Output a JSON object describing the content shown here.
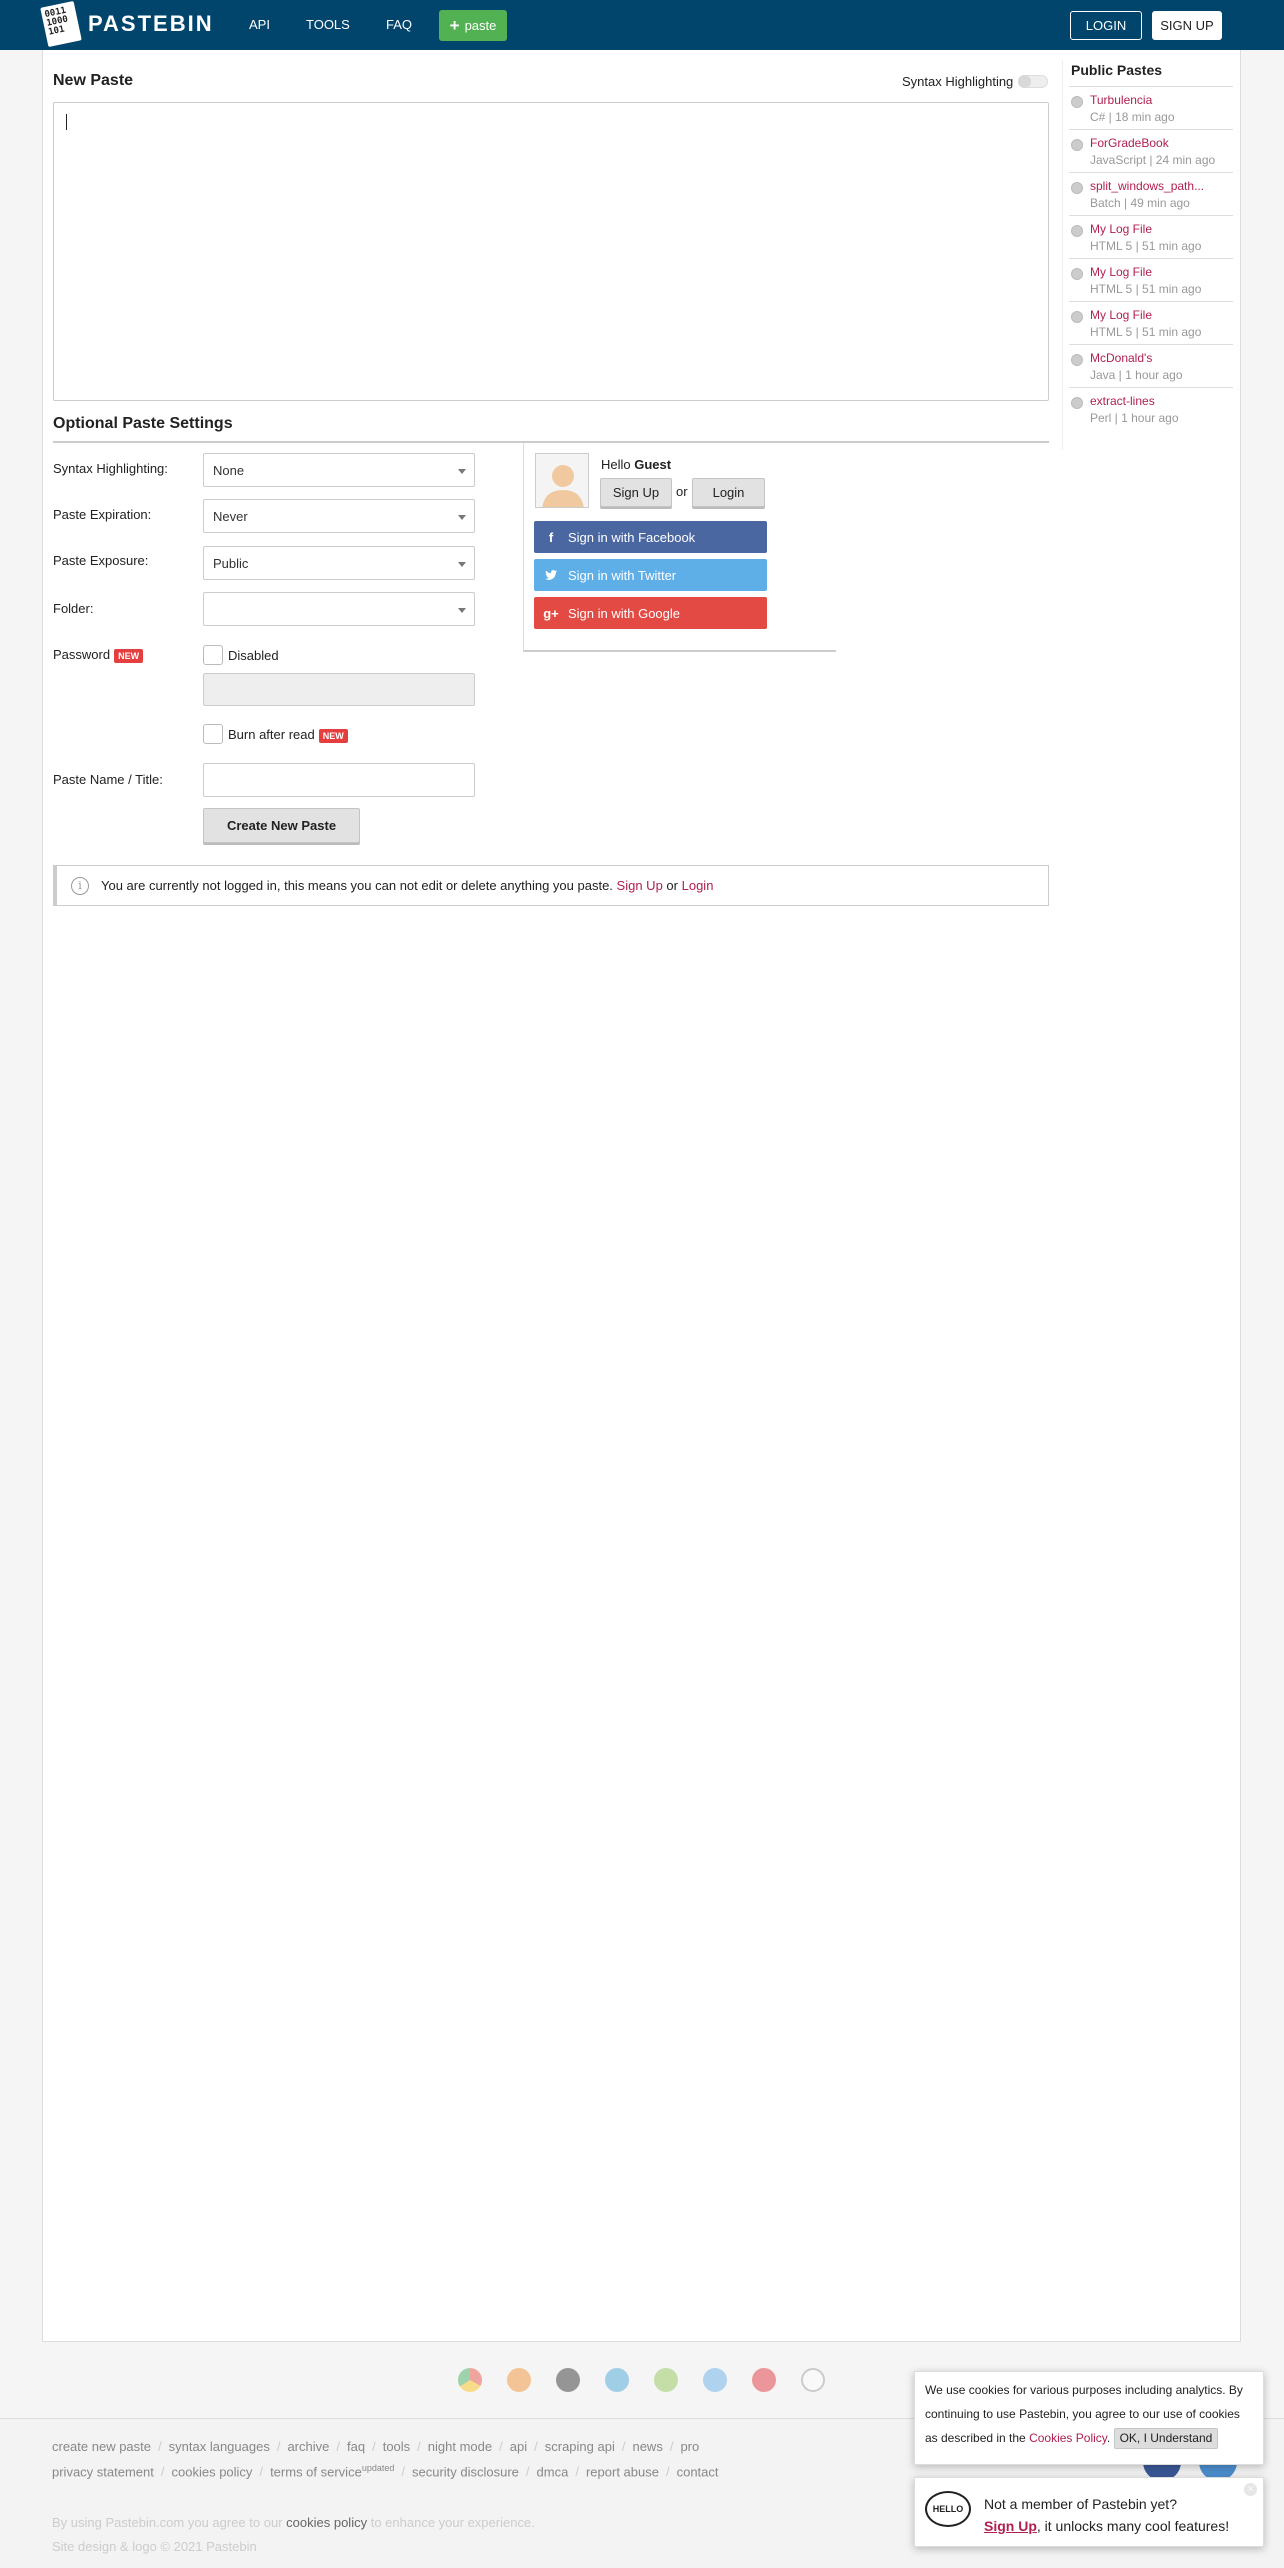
{
  "header": {
    "logo_digits": "0011\n1000\n101",
    "logo_text": "PASTEBIN",
    "nav": [
      "API",
      "TOOLS",
      "FAQ"
    ],
    "paste_label": "paste",
    "login": "LOGIN",
    "signup": "SIGN UP"
  },
  "editor": {
    "title": "New Paste",
    "syntax_toggle_label": "Syntax Highlighting"
  },
  "settings": {
    "title": "Optional Paste Settings",
    "syntax_label": "Syntax Highlighting:",
    "syntax_value": "None",
    "expiration_label": "Paste Expiration:",
    "expiration_value": "Never",
    "exposure_label": "Paste Exposure:",
    "exposure_value": "Public",
    "folder_label": "Folder:",
    "folder_value": "",
    "password_label": "Password",
    "new_badge": "NEW",
    "password_checkbox": "Disabled",
    "burn_label": "Burn after read",
    "name_label": "Paste Name / Title:",
    "create_button": "Create New Paste"
  },
  "guest": {
    "hello": "Hello",
    "name": "Guest",
    "signup": "Sign Up",
    "or": "or",
    "login": "Login",
    "facebook": "Sign in with Facebook",
    "twitter": "Sign in with Twitter",
    "google": "Sign in with Google"
  },
  "notice": {
    "text": "You are currently not logged in, this means you can not edit or delete anything you paste.",
    "signup": "Sign Up",
    "or": "or",
    "login": "Login"
  },
  "public_pastes": {
    "title": "Public Pastes",
    "items": [
      {
        "name": "Turbulencia",
        "meta": "C# | 18 min ago"
      },
      {
        "name": "ForGradeBook",
        "meta": "JavaScript | 24 min ago"
      },
      {
        "name": "split_windows_path...",
        "meta": "Batch | 49 min ago"
      },
      {
        "name": "My Log File",
        "meta": "HTML 5 | 51 min ago"
      },
      {
        "name": "My Log File",
        "meta": "HTML 5 | 51 min ago"
      },
      {
        "name": "My Log File",
        "meta": "HTML 5 | 51 min ago"
      },
      {
        "name": "McDonald's",
        "meta": "Java | 1 hour ago"
      },
      {
        "name": "extract-lines",
        "meta": "Perl | 1 hour ago"
      }
    ]
  },
  "footer": {
    "links_row1": [
      "create new paste",
      "syntax languages",
      "archive",
      "faq",
      "tools",
      "night mode",
      "api",
      "scraping api",
      "news",
      "pro"
    ],
    "links_row2": [
      "privacy statement",
      "cookies policy",
      "terms of service",
      "security disclosure",
      "dmca",
      "report abuse",
      "contact"
    ],
    "updated_sup": "updated",
    "note_pre": "By using Pastebin.com you agree to our",
    "note_link": "cookies policy",
    "note_post": "to enhance your experience.",
    "copyright": "Site design & logo © 2021 Pastebin"
  },
  "cookie_popup": {
    "text": "We use cookies for various purposes including analytics. By continuing to use Pastebin, you agree to our use of cookies as described in the",
    "link": "Cookies Policy",
    "period": ".",
    "button": "OK, I Understand"
  },
  "member_popup": {
    "icon_text": "HELLO",
    "question": "Not a member of Pastebin yet?",
    "cta": "Sign Up",
    "cta_rest": ", it unlocks many cool features!",
    "close": "×"
  },
  "colors": {
    "header_bg": "#02456c",
    "paste_green": "#52b153",
    "link_red": "#b02050",
    "facebook": "#4b67a1",
    "twitter": "#5eaee8",
    "google": "#e34a43"
  },
  "icons": {
    "browser_icons": [
      "chrome-icon",
      "firefox-icon",
      "ios-icon",
      "windows-icon",
      "android-icon",
      "x-icon",
      "opera-icon",
      "linux-icon"
    ]
  }
}
